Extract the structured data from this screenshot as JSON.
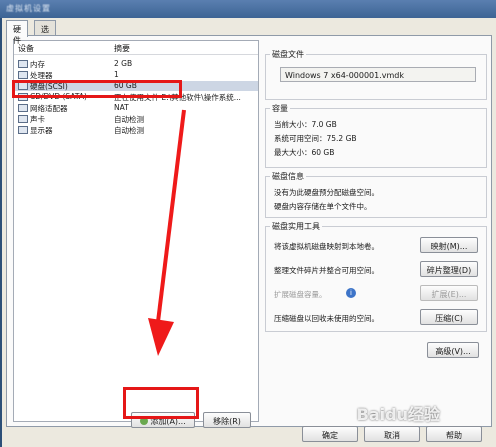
{
  "window": {
    "title": "虚拟机设置"
  },
  "tabs": [
    {
      "label": "硬件",
      "active": true
    },
    {
      "label": "选项",
      "active": false
    }
  ],
  "device_list": {
    "headers": {
      "device": "设备",
      "summary": "摘要"
    },
    "rows": [
      {
        "name": "内存",
        "summary": "2 GB",
        "icon": "memory-icon"
      },
      {
        "name": "处理器",
        "summary": "1",
        "icon": "processor-icon"
      },
      {
        "name": "硬盘(SCSI)",
        "summary": "60 GB",
        "icon": "harddisk-icon",
        "selected": true
      },
      {
        "name": "CD/DVD (SATA)",
        "summary": "正在使用文件 E:\\其他软件\\操作系统...",
        "icon": "cd-dvd-icon"
      },
      {
        "name": "网络适配器",
        "summary": "NAT",
        "icon": "network-adapter-icon"
      },
      {
        "name": "声卡",
        "summary": "自动检测",
        "icon": "sound-card-icon"
      },
      {
        "name": "显示器",
        "summary": "自动检测",
        "icon": "display-icon"
      }
    ],
    "add_button": "添加(A)...",
    "remove_button": "移除(R)"
  },
  "disk_file": {
    "title": "磁盘文件",
    "value": "Windows 7 x64-000001.vmdk"
  },
  "capacity": {
    "title": "容量",
    "current_size": "当前大小：7.0 GB",
    "system_free": "系统可用空间：75.2 GB",
    "max_size": "最大大小：60 GB"
  },
  "disk_info": {
    "title": "磁盘信息",
    "line1": "没有为此硬盘预分配磁盘空间。",
    "line2": "硬盘内容存储在单个文件中。"
  },
  "disk_utilities": {
    "title": "磁盘实用工具",
    "map_desc": "将该虚拟机磁盘映射到本地卷。",
    "map_button": "映射(M)...",
    "defrag_desc": "整理文件碎片并整合可用空间。",
    "defrag_button": "碎片整理(D)",
    "expand_desc": "扩展磁盘容量。",
    "expand_button": "扩展(E)...",
    "compact_desc": "压缩磁盘以回收未使用的空间。",
    "compact_button": "压缩(C)"
  },
  "advanced_button": "高级(V)...",
  "footer": {
    "ok": "确定",
    "cancel": "取消",
    "help": "帮助"
  },
  "watermark": "Baidu经验",
  "colors": {
    "annotation_red": "#e51717",
    "selection": "#cdd6e4"
  }
}
